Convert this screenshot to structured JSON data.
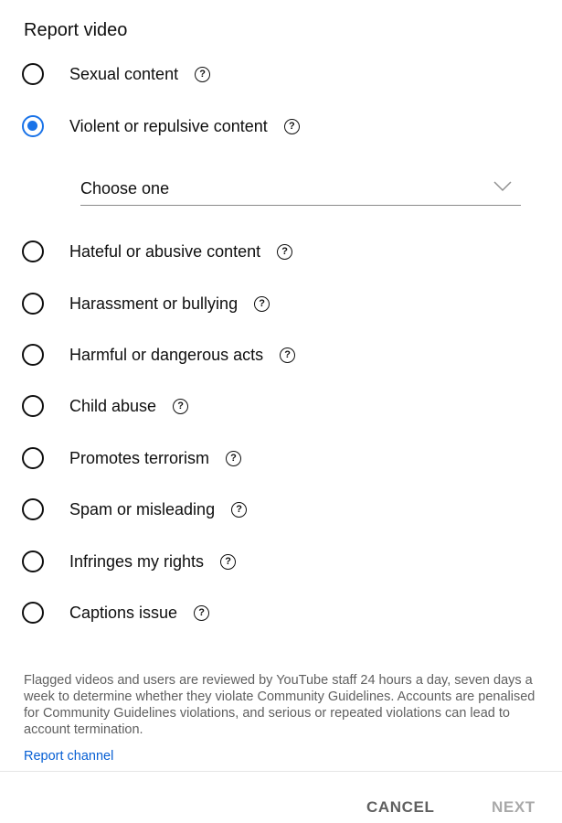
{
  "dialog": {
    "title": "Report video",
    "options": [
      {
        "label": "Sexual content",
        "checked": false
      },
      {
        "label": "Violent or repulsive content",
        "checked": true
      },
      {
        "label": "Hateful or abusive content",
        "checked": false
      },
      {
        "label": "Harassment or bullying",
        "checked": false
      },
      {
        "label": "Harmful or dangerous acts",
        "checked": false
      },
      {
        "label": "Child abuse",
        "checked": false
      },
      {
        "label": "Promotes terrorism",
        "checked": false
      },
      {
        "label": "Spam or misleading",
        "checked": false
      },
      {
        "label": "Infringes my rights",
        "checked": false
      },
      {
        "label": "Captions issue",
        "checked": false
      }
    ],
    "help_glyph": "?",
    "dropdown": {
      "value": "Choose one"
    },
    "info_text": "Flagged videos and users are reviewed by YouTube staff 24 hours a day, seven days a week to determine whether they violate Community Guidelines. Accounts are penalised for Community Guidelines violations, and serious or repeated violations can lead to account termination.",
    "report_channel_link": "Report channel",
    "buttons": {
      "cancel": "CANCEL",
      "next": "NEXT"
    }
  },
  "colors": {
    "accent": "#1a73e8",
    "text": "#0f0f0f",
    "secondary_text": "#606060",
    "link": "#065fd4",
    "disabled": "#a9a9a9"
  },
  "icons": {
    "help": "help-circle-icon",
    "dropdown": "chevron-down-icon"
  }
}
